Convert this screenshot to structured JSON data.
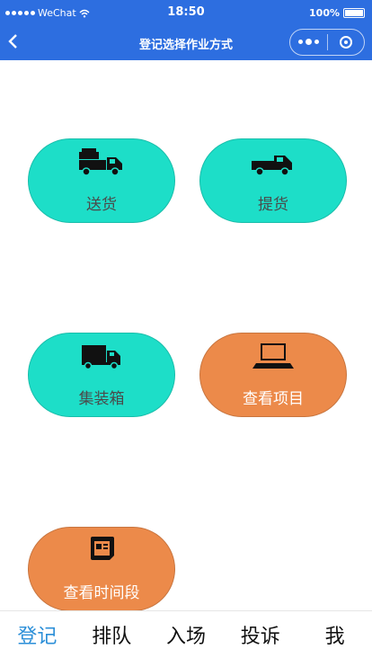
{
  "status": {
    "carrier": "WeChat",
    "time": "18:50",
    "battery": "100%"
  },
  "nav": {
    "back_icon": "chevron-left-icon",
    "title": "登记选择作业方式"
  },
  "tiles": {
    "delivery": {
      "label": "送货",
      "icon": "delivery-truck-icon",
      "color": "#1ddec8"
    },
    "pickup": {
      "label": "提货",
      "icon": "pickup-truck-icon",
      "color": "#1ddec8"
    },
    "container": {
      "label": "集装箱",
      "icon": "container-truck-icon",
      "color": "#1ddec8"
    },
    "projects": {
      "label": "查看项目",
      "icon": "laptop-icon",
      "color": "#ec8a4a"
    },
    "timeslots": {
      "label": "查看时间段",
      "icon": "calendar-icon",
      "color": "#ec8a4a"
    }
  },
  "tabbar": {
    "items": [
      "登记",
      "排队",
      "入场",
      "投诉",
      "我"
    ],
    "active_color": "#2c8fd8"
  }
}
